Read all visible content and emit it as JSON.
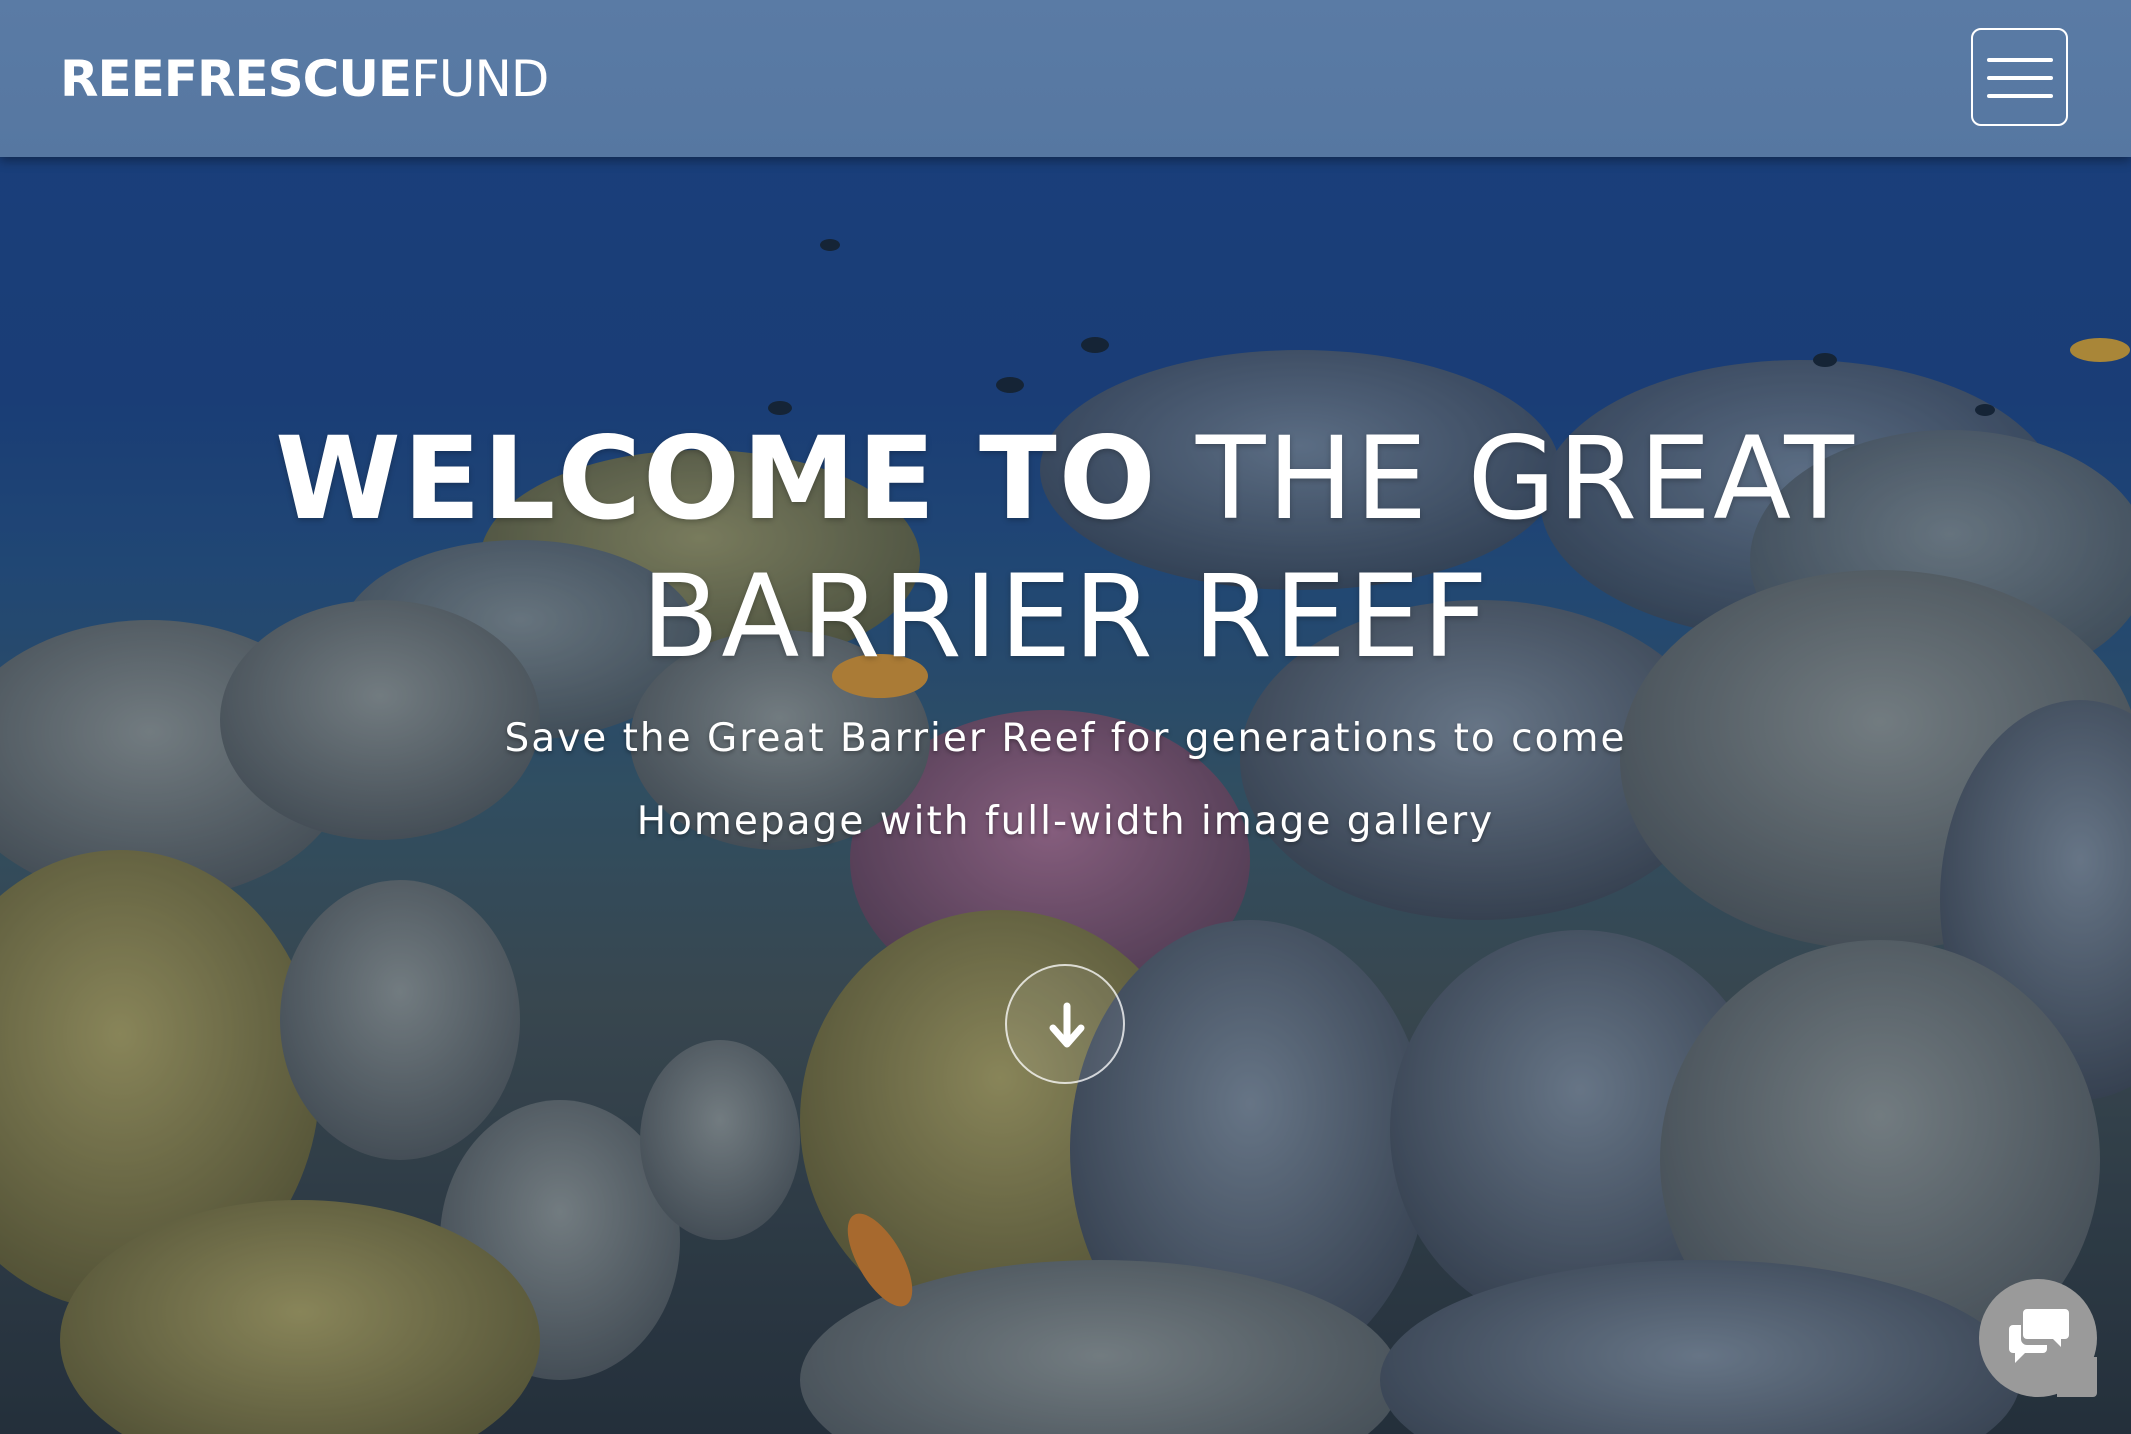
{
  "brand": {
    "bold": "REEFRESCUE",
    "light": "FUND"
  },
  "nav": {
    "menu_icon": "hamburger-menu-icon"
  },
  "hero": {
    "headline_strong": "WELCOME TO",
    "headline_rest": " THE GREAT BARRIER REEF",
    "subtitle": "Save the Great Barrier Reef for generations to come",
    "tagline": "Homepage with full-width image gallery",
    "scroll_icon": "arrow-down-icon",
    "background": "coral-reef-underwater-photo"
  },
  "chat": {
    "icon": "chat-bubbles-icon"
  },
  "colors": {
    "navbar": "#5677a1",
    "text": "#ffffff",
    "chat_button": "#9a9a9a"
  }
}
